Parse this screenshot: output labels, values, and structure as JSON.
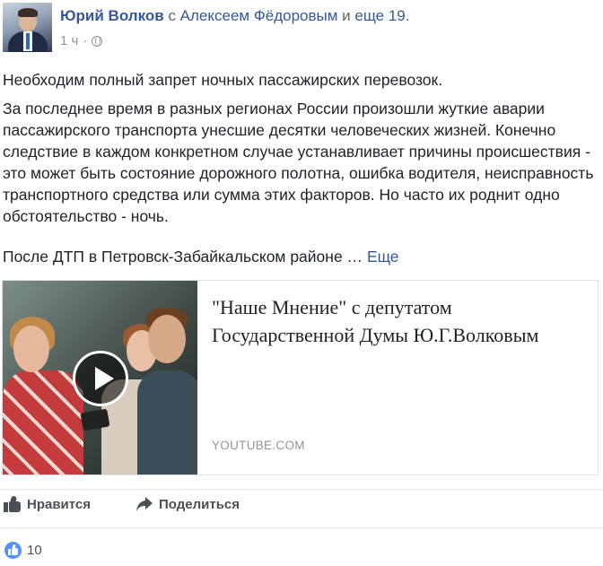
{
  "header": {
    "author": "Юрий Волков",
    "with_prefix": "с",
    "tagged_person": "Алексеем Фёдоровым",
    "and_text": "и",
    "more_people": "еще 19.",
    "timestamp": "1 ч",
    "separator": "·"
  },
  "post": {
    "paragraph_1": "Необходим полный запрет ночных пассажирских перевозок.",
    "paragraph_2": "За последнее время в разных регионах России произошли жуткие аварии пассажирского транспорта унесшие десятки человеческих жизней. Конечно следствие в каждом конкретном случае устанавливает причины происшествия - это может быть состояние дорожного полотна, ошибка водителя, неисправность транспортного средства или сумма этих факторов. Но часто их роднит одно обстоятельство - ночь.",
    "paragraph_3": "После ДТП в Петровск-Забайкальском районе …",
    "see_more": "Еще"
  },
  "link_card": {
    "title": "\"Наше Мнение\" с депутатом Государственной Думы Ю.Г.Волковым",
    "domain": "YOUTUBE.COM"
  },
  "actions": {
    "like_label": "Нравится",
    "share_label": "Поделиться"
  },
  "reactions": {
    "count": "10"
  },
  "colors": {
    "link": "#365899",
    "meta": "#90949c",
    "like_blue": "#5890ff"
  },
  "icons": [
    "globe-icon",
    "play-icon",
    "like-icon",
    "share-icon",
    "like-reaction-icon"
  ]
}
